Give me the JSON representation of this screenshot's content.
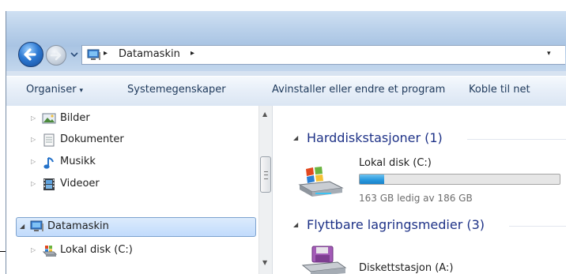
{
  "address_bar": {
    "crumb": "Datamaskin",
    "separator": "▸",
    "dropdown": "▾"
  },
  "command_bar": {
    "organize_label": "Organiser",
    "organize_caret": "▾",
    "system_properties_label": "Systemegenskaper",
    "uninstall_label": "Avinstaller eller endre et program",
    "map_drive_label": "Koble til net"
  },
  "nav_pane": {
    "items": [
      {
        "label": "Bilder",
        "icon": "pictures-library-icon"
      },
      {
        "label": "Dokumenter",
        "icon": "documents-library-icon"
      },
      {
        "label": "Musikk",
        "icon": "music-library-icon"
      },
      {
        "label": "Videoer",
        "icon": "videos-library-icon"
      }
    ],
    "computer": {
      "label": "Datamaskin",
      "icon": "computer-icon",
      "selected": true
    },
    "drive": {
      "label": "Lokal disk (C:)",
      "icon": "local-disk-icon"
    },
    "expand_glyph": "▷",
    "collapse_glyph": "◢"
  },
  "content": {
    "groups": [
      {
        "title": "Harddiskstasjoner (1)",
        "items": [
          {
            "name": "Lokal disk (C:)",
            "subtitle": "163 GB ledig av 186 GB",
            "used_fraction": 0.124,
            "icon": "hard-drive-icon"
          }
        ]
      },
      {
        "title": "Flyttbare lagringsmedier (3)",
        "items": [
          {
            "name": "Diskettstasjon (A:)",
            "icon": "floppy-drive-icon"
          }
        ]
      }
    ],
    "group_caret": "◢"
  },
  "colors": {
    "accent": "#1e3287",
    "selection": "#c1dbfc",
    "bar_fill": "#2a9adf"
  }
}
